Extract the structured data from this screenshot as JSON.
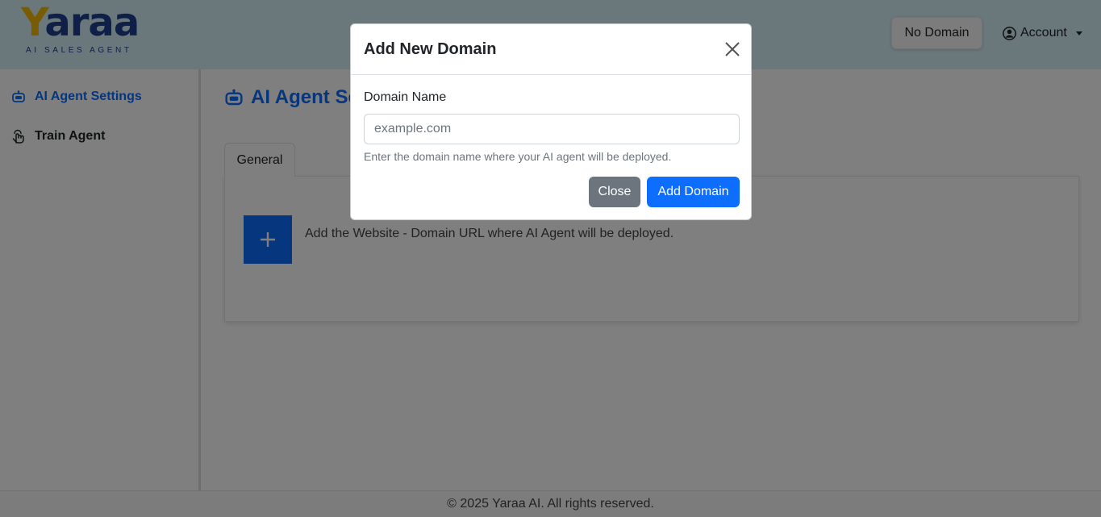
{
  "header": {
    "logo_word_first": "Y",
    "logo_word_rest": "araa",
    "logo_tagline": "AI SALES AGENT",
    "domain_button_label": "No Domain",
    "account_label": "Account",
    "account_icon": "user-circle-icon",
    "account_caret_icon": "caret-down-icon"
  },
  "sidebar": {
    "items": [
      {
        "label": "AI Agent Settings",
        "icon": "robot-icon",
        "active": true
      },
      {
        "label": "Train Agent",
        "icon": "hand-touch-icon",
        "active": false
      }
    ]
  },
  "main": {
    "title": "AI Agent Se",
    "title_icon": "robot-icon",
    "tabs": [
      {
        "label": "General",
        "active": true
      }
    ],
    "add_domain_icon": "plus-icon",
    "add_domain_text": "Add the Website - Domain URL where AI Agent will be deployed."
  },
  "footer": {
    "text": "© 2025 Yaraa AI. All rights reserved."
  },
  "modal": {
    "title": "Add New Domain",
    "close_icon": "close-icon",
    "field_label": "Domain Name",
    "field_value": "",
    "field_placeholder": "example.com",
    "help_text": "Enter the domain name where your AI agent will be deployed.",
    "close_button_label": "Close",
    "submit_button_label": "Add Domain"
  },
  "colors": {
    "primary": "#0d6efd",
    "secondary": "#6c757d",
    "header_bg": "#d4eef7",
    "logo_yellow": "#f2b705",
    "logo_navy": "#1f3f8f",
    "backdrop": "rgba(0,0,0,0.5)"
  }
}
